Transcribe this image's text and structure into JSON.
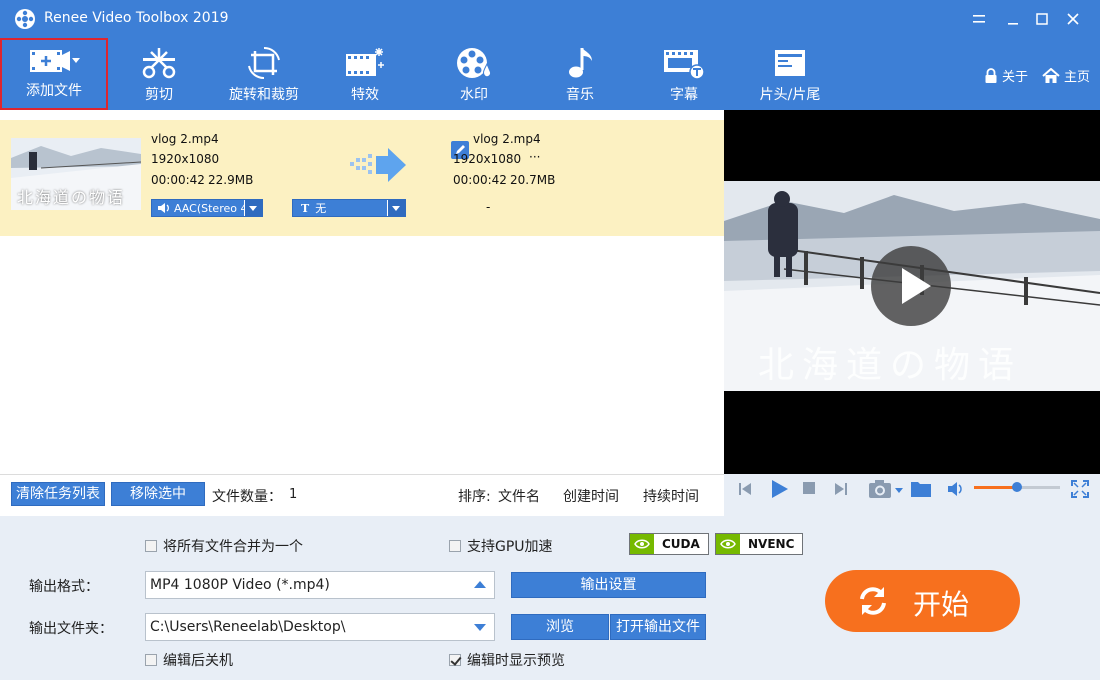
{
  "app": {
    "title": "Renee Video Toolbox 2019"
  },
  "toolbar": {
    "items": [
      {
        "label": "添加文件",
        "icon": "add-file-icon"
      },
      {
        "label": "剪切",
        "icon": "cut-icon"
      },
      {
        "label": "旋转和裁剪",
        "icon": "rotate-crop-icon"
      },
      {
        "label": "特效",
        "icon": "effects-icon"
      },
      {
        "label": "水印",
        "icon": "watermark-icon"
      },
      {
        "label": "音乐",
        "icon": "music-icon"
      },
      {
        "label": "字幕",
        "icon": "subtitle-icon"
      },
      {
        "label": "片头/片尾",
        "icon": "intro-outro-icon"
      }
    ],
    "about": "关于",
    "home": "主页"
  },
  "file": {
    "thumb_caption": "北海道の物语",
    "source": {
      "name": "vlog 2.mp4",
      "resolution": "1920x1080",
      "duration": "00:00:42",
      "size": "22.9MB"
    },
    "output": {
      "name": "vlog 2.mp4",
      "resolution": "1920x1080",
      "more": "···",
      "duration": "00:00:42",
      "size": "20.7MB"
    },
    "audio_track": "AAC(Stereo 4",
    "subtitle_prefix": "T",
    "subtitle_value": "无",
    "dash": "-"
  },
  "preview": {
    "caption": "北海道の物语"
  },
  "list_footer": {
    "clear_label": "清除任务列表",
    "remove_label": "移除选中",
    "count_label": "文件数量：",
    "count_value": "1",
    "sort_label": "排序:",
    "sort_name": "文件名",
    "sort_created": "创建时间",
    "sort_duration": "持续时间"
  },
  "settings": {
    "merge_label": "将所有文件合并为一个",
    "merge_checked": false,
    "gpu_label": "支持GPU加速",
    "gpu_checked": false,
    "cuda": "CUDA",
    "nvenc": "NVENC",
    "format_label": "输出格式：",
    "format_value": "MP4 1080P Video (*.mp4)",
    "output_settings_label": "输出设置",
    "folder_label": "输出文件夹：",
    "folder_value": "C:\\Users\\Reneelab\\Desktop\\",
    "browse_label": "浏览",
    "open_folder_label": "打开输出文件",
    "shutdown_label": "编辑后关机",
    "shutdown_checked": false,
    "show_preview_label": "编辑时显示预览",
    "show_preview_checked": true,
    "start_label": "开始"
  },
  "colors": {
    "accent": "#3d7fd6",
    "selected_row": "#fcf1c2",
    "start": "#f7701e",
    "nvidia": "#76b900"
  },
  "player": {
    "volume_fraction": 0.5
  }
}
